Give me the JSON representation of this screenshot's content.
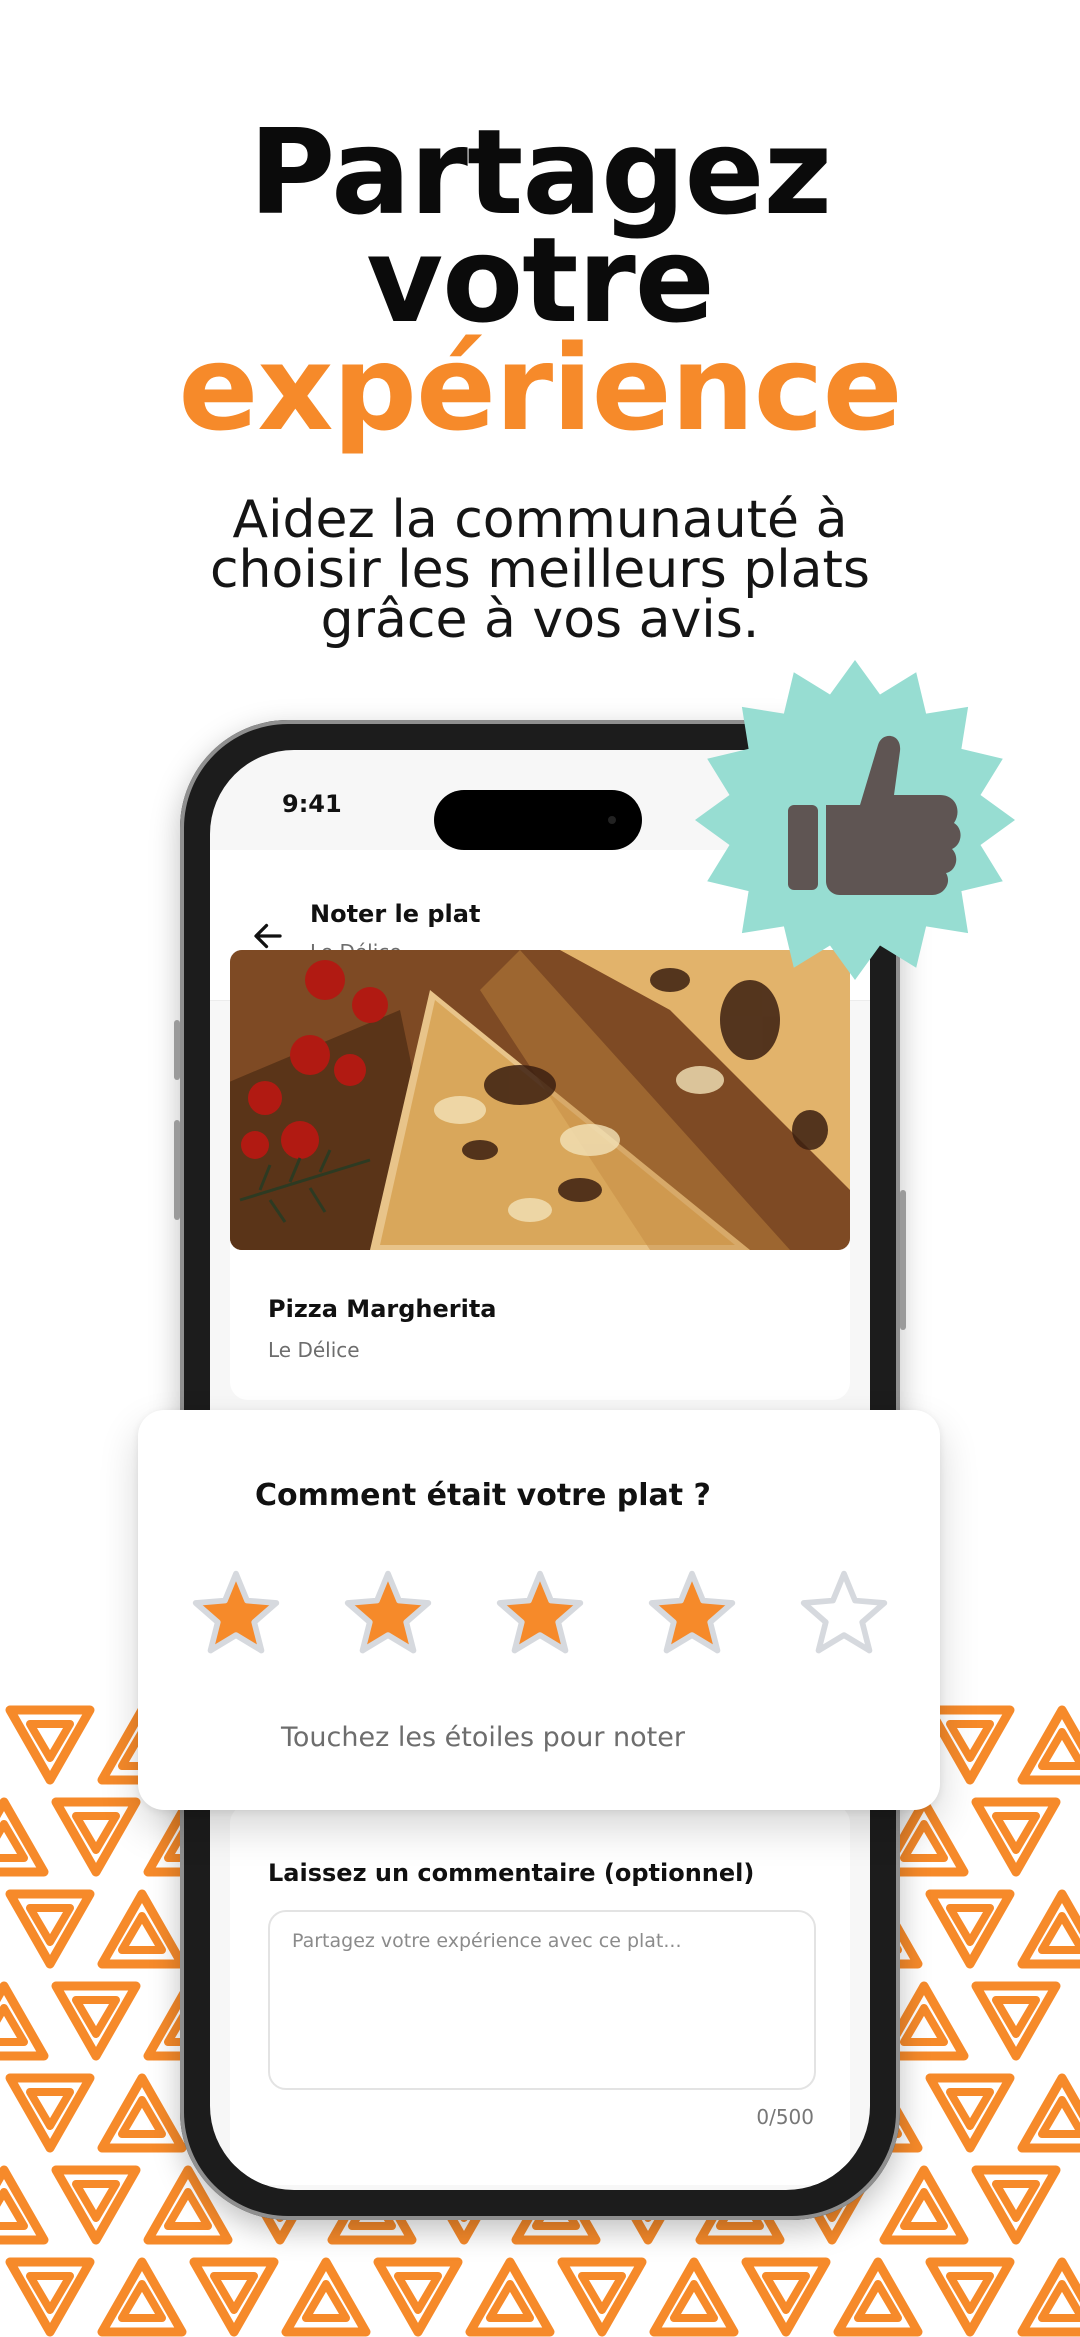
{
  "hero": {
    "line1": "Partagez",
    "line2": "votre",
    "line3": "expérience",
    "subtitle": "Aidez la communauté à choisir les meilleurs plats grâce à vos avis."
  },
  "status_bar": {
    "time": "9:41"
  },
  "app_bar": {
    "title": "Noter le plat",
    "subtitle": "Le Délice"
  },
  "dish": {
    "name": "Pizza Margherita",
    "restaurant": "Le Délice"
  },
  "rating": {
    "question": "Comment était votre plat ?",
    "hint": "Touchez les étoiles pour noter",
    "value": 4,
    "max": 5
  },
  "comment": {
    "label": "Laissez un commentaire (optionnel)",
    "placeholder": "Partagez votre expérience avec ce plat...",
    "value": "",
    "counter": "0/500"
  },
  "colors": {
    "accent": "#f68a2a",
    "badge": "#97ddd2",
    "thumb": "#5f5553",
    "star_empty": "#d6d9de"
  }
}
